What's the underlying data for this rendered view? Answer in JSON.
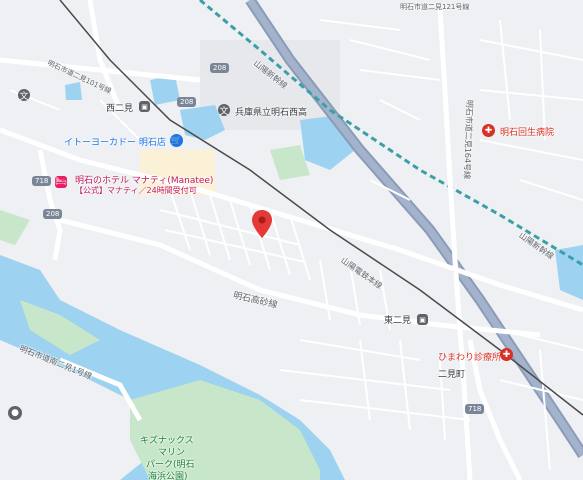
{
  "map": {
    "places": {
      "nishi_futami_station": "西二見",
      "ito_yokado": "イトーヨーカドー 明石店",
      "hyogo_high_school": "兵庫県立明石西高",
      "hotel_name": "明石のホテル マナティ(Manatee)",
      "hotel_sub": "【公式】マナティ／24時間受付可",
      "akashi_kaisei_hospital": "明石回生病院",
      "himawari_clinic": "ひまわり診療所",
      "higashi_futami_station": "東二見",
      "futami_town": "二見町",
      "park_line1": "キズナックス",
      "park_line2": "マリン",
      "park_line3": "パーク(明石",
      "park_line4": "海浜公園)"
    },
    "roads": {
      "sanyo_shinkansen_1": "山陽新幹線",
      "sanyo_shinkansen_2": "山陽新幹線",
      "sanyo_main_line": "山陽電鉄本線",
      "akashi_takasago": "明石高砂線",
      "city_road_minami": "明石市道南二見1号線",
      "city_road_kita": "明石市道二見164号線",
      "city_road_west": "明石市道二見101号線",
      "city_road_top": "明石市道二見121号線"
    },
    "shields": {
      "r208_a": "208",
      "r208_b": "208",
      "r208_c": "208",
      "r718_a": "718",
      "r718_b": "718"
    },
    "colors": {
      "water": "#9dd3f0",
      "park": "#c8e6c9",
      "highway": "#8a9bb8",
      "rail": "#4a4a4a",
      "shinkansen": "#3aa0a8",
      "pin": "#e53935"
    }
  }
}
